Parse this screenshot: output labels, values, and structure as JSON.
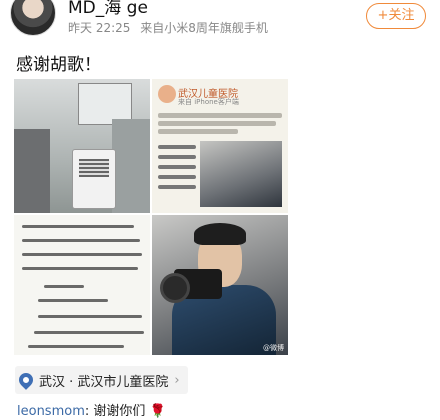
{
  "post": {
    "username": "MD_海 ge",
    "time": "昨天 22:25",
    "source": "来自小米8周年旗舰手机",
    "follow_label": "+关注",
    "text": "感谢胡歌！"
  },
  "images": {
    "statement": {
      "title": "武汉儿童医院",
      "handle": "来自 iPhone客户端"
    },
    "watermark": "@微博"
  },
  "location": {
    "label": "武汉 · 武汉市儿童医院"
  },
  "comment": {
    "user": "leonsmom",
    "text": "谢谢你们",
    "emoji": "🌹"
  },
  "icons": {
    "location": "map-pin-icon",
    "chevron": "chevron-right-icon"
  },
  "colors": {
    "follow": "#f08a3a",
    "link": "#3c6aa6",
    "location_pin": "#3f6fb5"
  }
}
